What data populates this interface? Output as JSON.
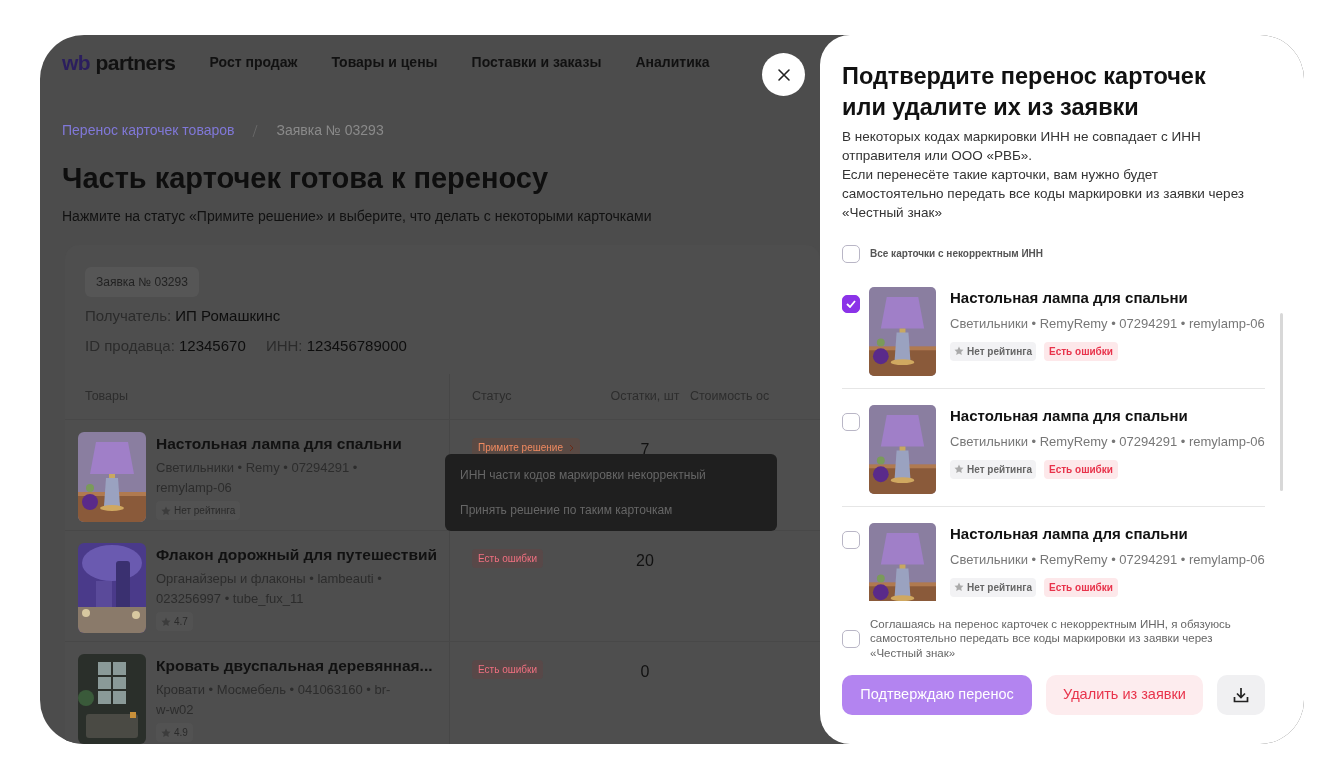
{
  "nav": {
    "logo_wb": "wb",
    "logo_partners": "partners",
    "items": [
      "Рост продаж",
      "Товары и цены",
      "Поставки и заказы",
      "Аналитика"
    ]
  },
  "breadcrumbs": [
    {
      "label": "Перенос карточек товаров",
      "kind": "link"
    },
    {
      "label": "Заявка № 03293",
      "kind": "current"
    }
  ],
  "page_title": "Часть карточек готова к переносу",
  "page_subtitle": "Нажмите на статус «Примите решение» и выберите, что делать с некоторыми карточками",
  "request": {
    "badge": "Заявка № 03293",
    "recipient_label": "Получатель:",
    "recipient": "ИП Ромашкинс",
    "seller_id_label": "ID продавца:",
    "seller_id": "12345670",
    "inn_label": "ИНН:",
    "inn": "123456789000"
  },
  "table": {
    "columns": [
      "Товары",
      "Статус",
      "Остатки, шт",
      "Стоимость ос"
    ],
    "rows": [
      {
        "name": "Настольная лампа для спальни",
        "meta": "Светильники • Remy • 07294291 • remylamp-06",
        "rating": "Нет рейтинга",
        "status": "Примите решение",
        "stock": "7"
      },
      {
        "name": "Флакон дорожный для путешествий",
        "meta": "Органайзеры и флаконы • lambeauti • 023256997 • tube_fux_11",
        "rating": "4.7",
        "status": "Есть ошибки",
        "stock": "20"
      },
      {
        "name": "Кровать двуспальная деревянная...",
        "meta": "Кровати • Мосмебель • 041063160 • br-w-w02",
        "rating": "4.9",
        "status": "Есть ошибки",
        "stock": "0"
      }
    ]
  },
  "tooltip": {
    "text": "ИНН части кодов маркировки некорректный",
    "link": "Принять решение по таким карточкам"
  },
  "panel": {
    "title": "Подтвердите перенос карточек или удалите их из заявки",
    "description": [
      "В некоторых кодах маркировки ИНН не совпадает с ИНН отправителя или ООО «РВБ».",
      "Если перенесёте такие карточки, вам нужно будет самостоятельно передать все коды маркировки из заявки через «Честный знак»"
    ],
    "select_all": {
      "label": "Все карточки с некорректным ИНН",
      "checked": false
    },
    "items": [
      {
        "name": "Настольная лампа для спальни",
        "meta": "Светильники • RemyRemy • 07294291 • remylamp-06",
        "rating": "Нет рейтинга",
        "status": "Есть ошибки",
        "checked": true
      },
      {
        "name": "Настольная лампа для спальни",
        "meta": "Светильники • RemyRemy • 07294291 • remylamp-06",
        "rating": "Нет рейтинга",
        "status": "Есть ошибки",
        "checked": false
      },
      {
        "name": "Настольная лампа для спальни",
        "meta": "Светильники • RemyRemy • 07294291 • remylamp-06",
        "rating": "Нет рейтинга",
        "status": "Есть ошибки",
        "checked": false
      }
    ],
    "consent": {
      "label": "Соглашаясь на перенос карточек с некорректным ИНН, я обязуюсь самостоятельно передать все коды маркировки из заявки через «Честный знак»",
      "checked": false
    },
    "confirm_button": {
      "label": "Подтверждаю перенос",
      "disabled": true
    },
    "delete_button": {
      "label": "Удалить из заявки"
    }
  }
}
